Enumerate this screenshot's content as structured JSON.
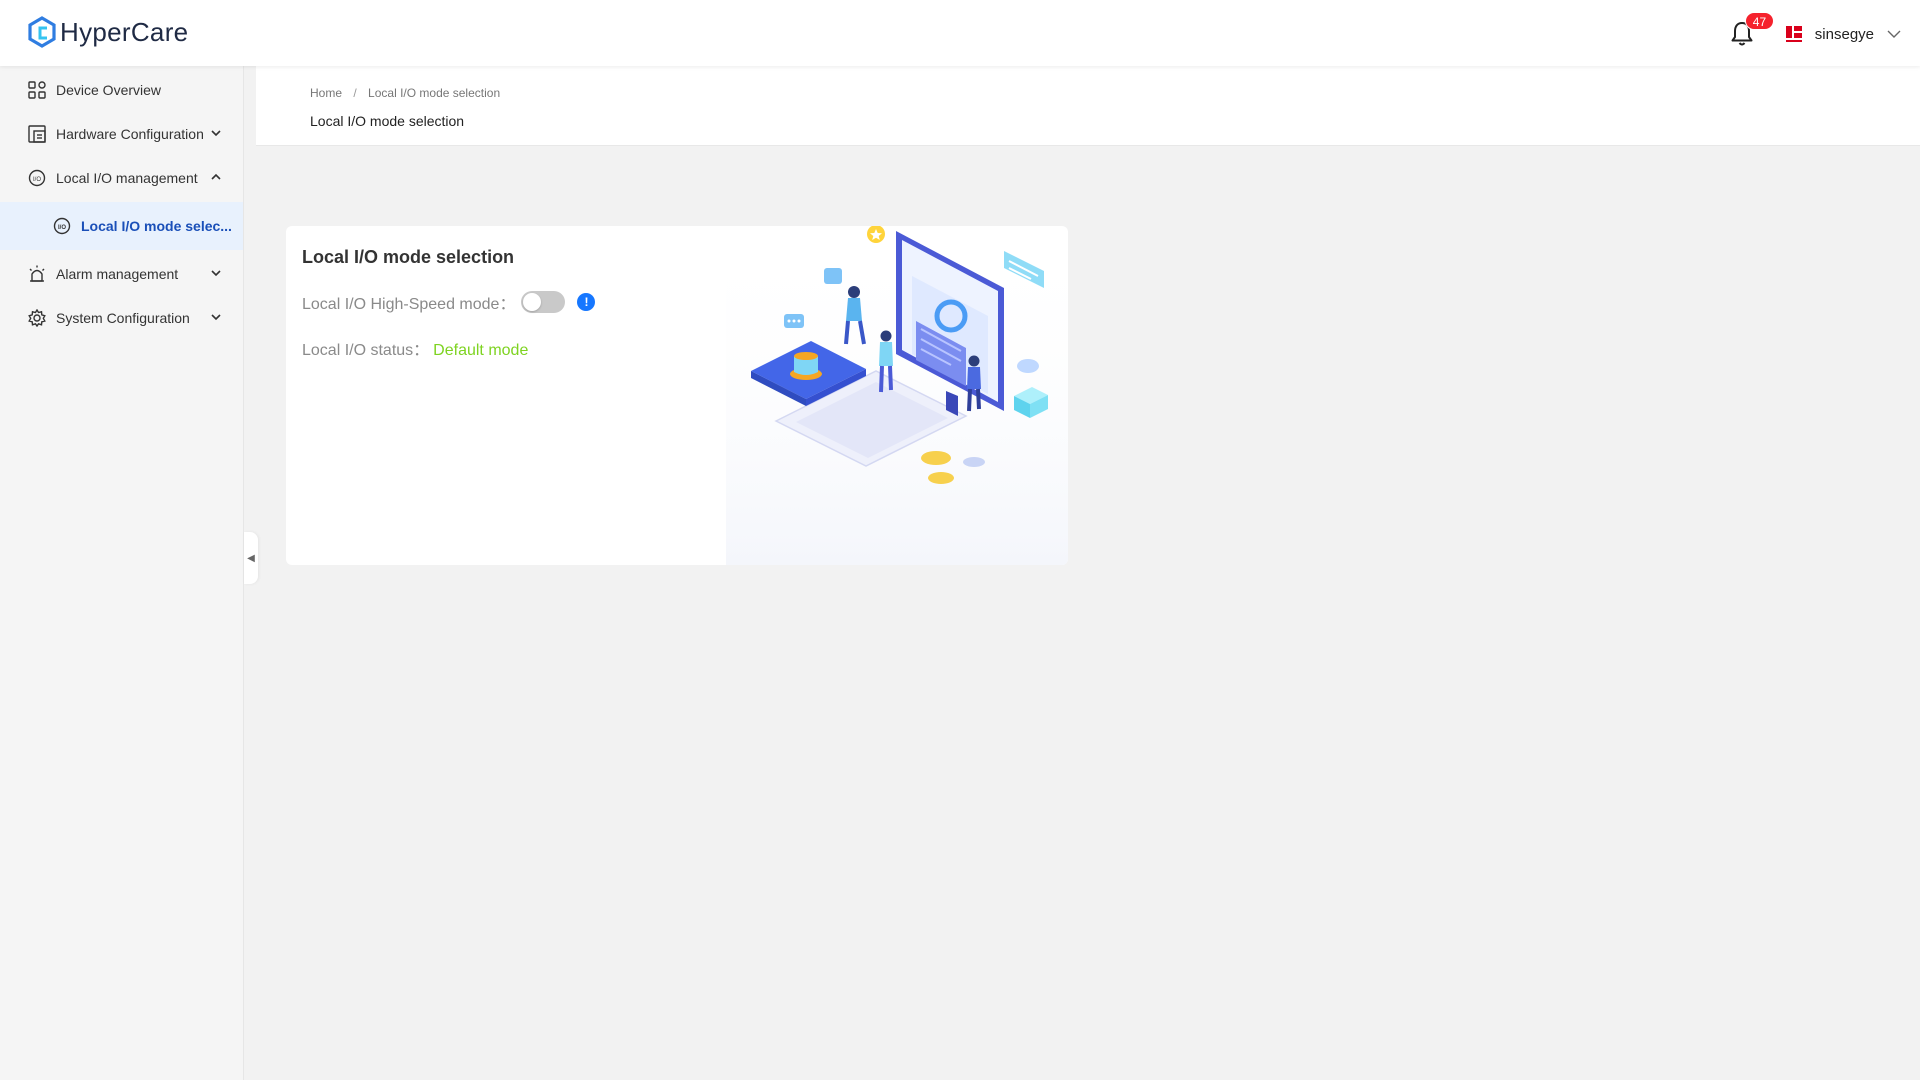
{
  "app": {
    "name": "HyperCare"
  },
  "header": {
    "notification_count": "47",
    "username": "sinsegye"
  },
  "sidebar": {
    "items": [
      {
        "label": "Device Overview"
      },
      {
        "label": "Hardware Configuration"
      },
      {
        "label": "Local I/O management"
      },
      {
        "label": "Local I/O mode selec..."
      },
      {
        "label": "Alarm management"
      },
      {
        "label": "System Configuration"
      }
    ]
  },
  "breadcrumb": {
    "home": "Home",
    "separator": "/",
    "current": "Local I/O mode selection"
  },
  "page": {
    "title": "Local I/O mode selection"
  },
  "card": {
    "title": "Local I/O mode selection",
    "high_speed_label": "Local I/O High-Speed mode：",
    "high_speed_enabled": false,
    "info_symbol": "!",
    "status_label": "Local I/O status：",
    "status_value": "Default mode"
  },
  "colors": {
    "accent": "#1677ff",
    "active_nav": "#1a4fb8",
    "status_ok": "#7ed321",
    "badge": "#f5222d"
  },
  "icons": {
    "logo": "hypercare-logo-icon",
    "bell": "bell-icon",
    "user_logo": "company-logo-icon",
    "user_menu": "chevron-down-icon"
  }
}
